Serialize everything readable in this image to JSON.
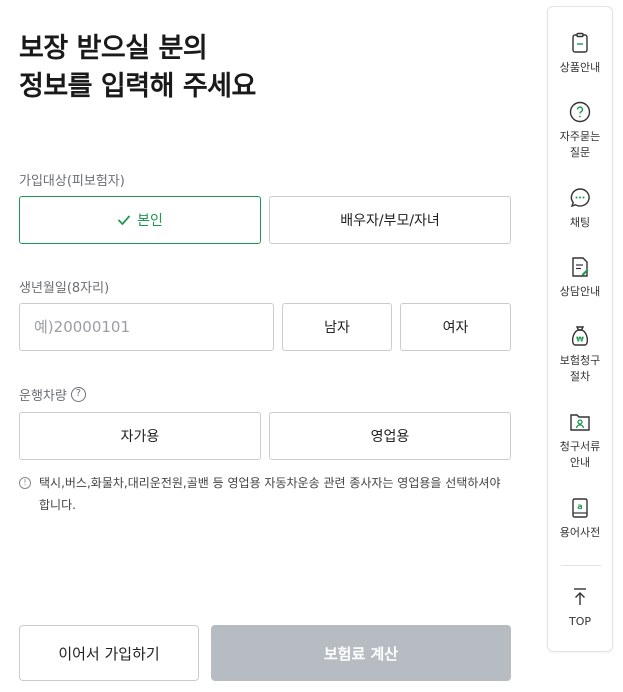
{
  "title": {
    "line1": "보장 받으실 분의",
    "line2": "정보를 입력해 주세요"
  },
  "insured": {
    "label": "가입대상(피보험자)",
    "options": [
      "본인",
      "배우자/부모/자녀"
    ],
    "selected": "본인"
  },
  "birth": {
    "label": "생년월일(8자리)",
    "placeholder": "예)20000101",
    "value": "",
    "gender_options": [
      "남자",
      "여자"
    ]
  },
  "vehicle": {
    "label": "운행차량",
    "help_glyph": "?",
    "options": [
      "자가용",
      "영업용"
    ]
  },
  "notice": {
    "text": "택시,버스,화물차,대리운전원,골밴 등 영업용 자동차운송 관련 종사자는 영업용을 선택하셔야 합니다."
  },
  "buttons": {
    "continue": "이어서 가입하기",
    "calculate": "보험료 계산"
  },
  "sidebar": {
    "items": [
      {
        "label": "상품안내",
        "icon": "clipboard-icon"
      },
      {
        "label": "자주묻는 질문",
        "icon": "question-circle-icon"
      },
      {
        "label": "채팅",
        "icon": "chat-bubble-icon"
      },
      {
        "label": "상담안내",
        "icon": "document-pen-icon"
      },
      {
        "label": "보험청구 절차",
        "icon": "money-bag-icon"
      },
      {
        "label": "청구서류 안내",
        "icon": "folder-person-icon"
      },
      {
        "label": "용어사전",
        "icon": "dictionary-icon"
      }
    ],
    "top": "TOP"
  },
  "colors": {
    "accent": "#1f9950",
    "disabled": "#b7bcc3",
    "border": "#c9ccd1"
  }
}
